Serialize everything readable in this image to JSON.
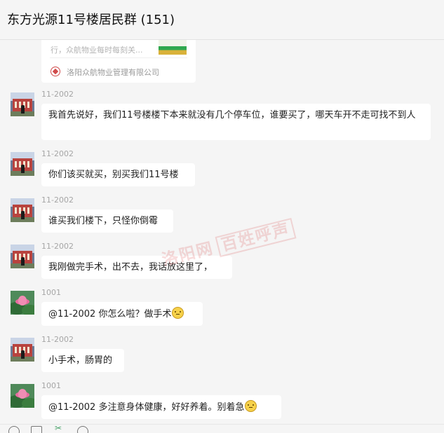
{
  "window": {
    "title": "东方光源11号楼居民群 (151)"
  },
  "shared_card": {
    "description": "行，众航物业每时每刻关...",
    "source": "洛阳众航物业管理有限公司"
  },
  "messages": [
    {
      "sender": "11-2002",
      "text": "我首先说好，我们11号楼楼下本来就没有几个停车位，谁要买了，哪天车开不走可找不到人",
      "avatar": "building-avatar"
    },
    {
      "sender": "11-2002",
      "text": "你们该买就买，别买我们11号楼",
      "avatar": "building-avatar"
    },
    {
      "sender": "11-2002",
      "text": "谁买我们楼下，只怪你倒霉",
      "avatar": "building-avatar"
    },
    {
      "sender": "11-2002",
      "text": "我刚做完手术，出不去，我话放这里了，",
      "avatar": "building-avatar"
    },
    {
      "sender": "1001",
      "text": "@11-2002 你怎么啦？做手术",
      "emoji": "smile-emoji",
      "avatar": "lotus-avatar"
    },
    {
      "sender": "11-2002",
      "text": "小手术，肠胃的",
      "avatar": "building-avatar"
    },
    {
      "sender": "1001",
      "text": "@11-2002 多注意身体健康，好好养着。别着急",
      "emoji": "smile-emoji",
      "avatar": "lotus-avatar"
    }
  ],
  "watermark": {
    "part1": "洛阳网",
    "part2": "百姓呼声"
  },
  "toolbar": {
    "icons": [
      "emoji-icon",
      "folder-icon",
      "scissors-icon",
      "chat-history-icon"
    ]
  }
}
